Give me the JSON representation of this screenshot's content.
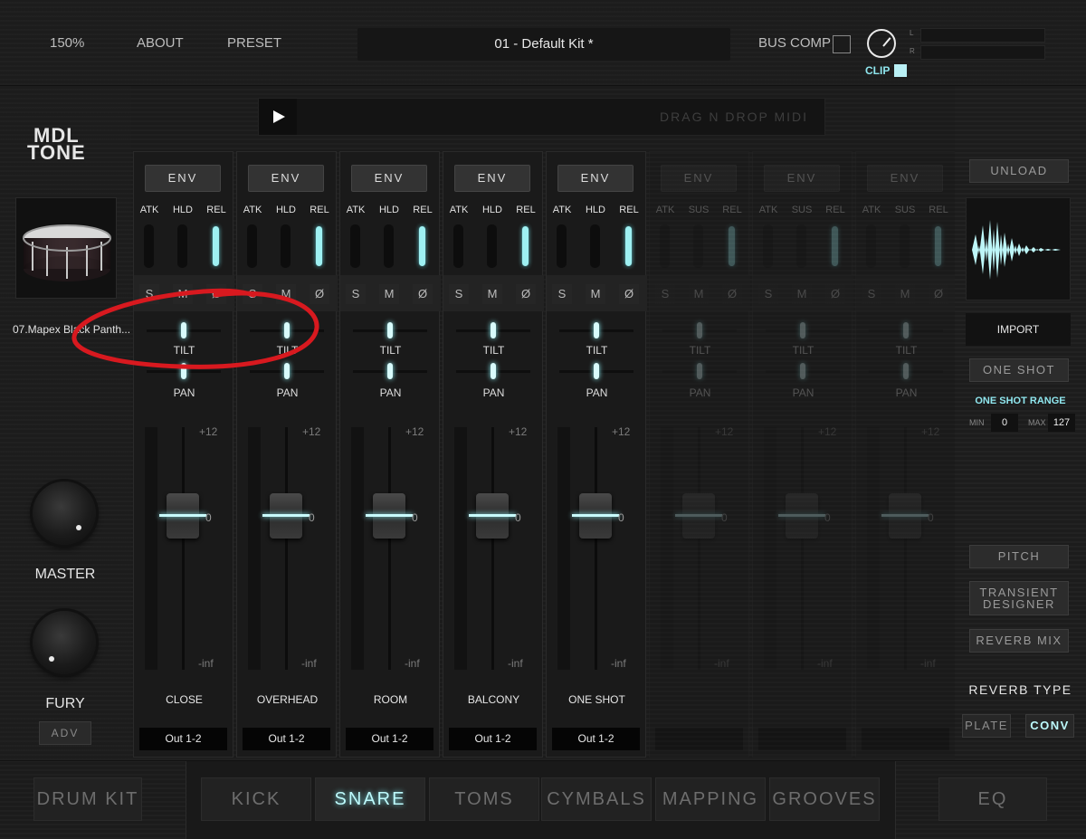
{
  "topbar": {
    "zoom": "150%",
    "about": "ABOUT",
    "preset": "PRESET",
    "preset_name": "01 - Default Kit *",
    "bus_comp": "BUS COMP",
    "clip": "CLIP",
    "meter_left": "L",
    "meter_right": "R"
  },
  "left": {
    "logo_line1": "MDL",
    "logo_line2": "TONE",
    "kit_name": "07.Mapex Black Panth...",
    "master_label": "MASTER",
    "fury_label": "FURY",
    "adv": "ADV"
  },
  "midi": {
    "drag_text": "DRAG N DROP MIDI"
  },
  "channel_labels": {
    "env": "ENV",
    "atk": "ATK",
    "hld": "HLD",
    "rel": "REL",
    "sus": "SUS",
    "solo": "S",
    "mute": "M",
    "phase": "Ø",
    "tilt": "TILT",
    "pan": "PAN",
    "fader_top": "+12",
    "fader_zero": "0",
    "fader_bottom": "-inf"
  },
  "channels": [
    {
      "name": "CLOSE",
      "output": "Out 1-2"
    },
    {
      "name": "OVERHEAD",
      "output": "Out 1-2"
    },
    {
      "name": "ROOM",
      "output": "Out 1-2"
    },
    {
      "name": "BALCONY",
      "output": "Out 1-2"
    },
    {
      "name": "ONE SHOT",
      "output": "Out 1-2"
    },
    {
      "name": "",
      "output": ""
    },
    {
      "name": "",
      "output": ""
    },
    {
      "name": "",
      "output": ""
    }
  ],
  "right": {
    "unload": "UNLOAD",
    "import": "IMPORT",
    "one_shot": "ONE SHOT",
    "one_shot_range": "ONE SHOT RANGE",
    "min_label": "MIN",
    "min_value": "0",
    "max_label": "MAX",
    "max_value": "127",
    "pitch": "PITCH",
    "transient_1": "TRANSIENT",
    "transient_2": "DESIGNER",
    "reverb_mix": "REVERB MIX",
    "reverb_type": "REVERB TYPE",
    "plate": "PLATE",
    "conv": "CONV"
  },
  "bottom": {
    "drum_kit": "DRUM KIT",
    "tabs": [
      "KICK",
      "SNARE",
      "TOMS",
      "CYMBALS",
      "MAPPING",
      "GROOVES"
    ],
    "active_tab": "SNARE",
    "eq": "EQ"
  },
  "colors": {
    "accent": "#8fe6ee",
    "annotation": "#d8191f"
  }
}
